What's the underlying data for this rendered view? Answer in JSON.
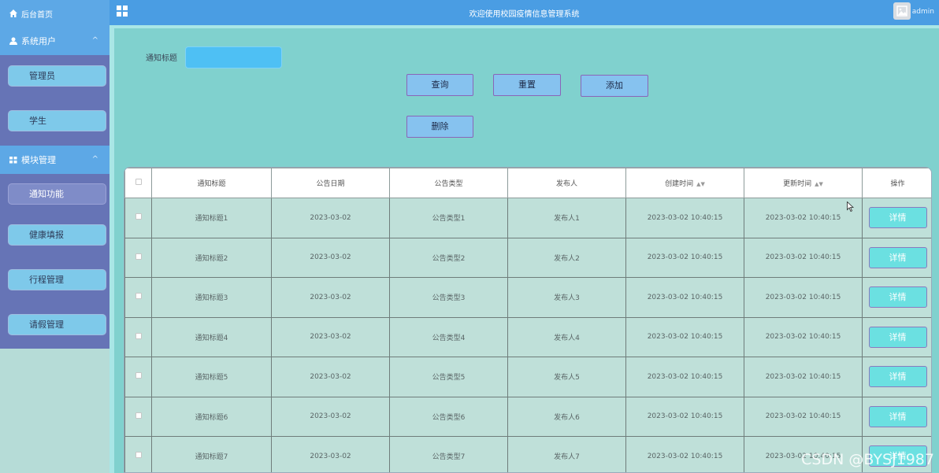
{
  "sidebar": {
    "home_label": "后台首页",
    "groups": [
      {
        "label": "系统用户",
        "items": [
          "管理员",
          "学生"
        ]
      },
      {
        "label": "模块管理",
        "items": [
          "通知功能",
          "健康填报",
          "行程管理",
          "请假管理"
        ]
      }
    ],
    "active_item": "通知功能"
  },
  "header": {
    "title": "欢迎使用校园疫情信息管理系统",
    "user": "admin"
  },
  "search": {
    "label": "通知标题",
    "value": "",
    "placeholder": ""
  },
  "toolbar": {
    "query_label": "查询",
    "reset_label": "重置",
    "add_label": "添加",
    "delete_label": "删除"
  },
  "table": {
    "columns": [
      "通知标题",
      "公告日期",
      "公告类型",
      "发布人",
      "创建时间",
      "更新时间",
      "操作"
    ],
    "action_label": "详情",
    "rows": [
      [
        "通知标题1",
        "2023-03-02",
        "公告类型1",
        "发布人1",
        "2023-03-02 10:40:15",
        "2023-03-02 10:40:15"
      ],
      [
        "通知标题2",
        "2023-03-02",
        "公告类型2",
        "发布人2",
        "2023-03-02 10:40:15",
        "2023-03-02 10:40:15"
      ],
      [
        "通知标题3",
        "2023-03-02",
        "公告类型3",
        "发布人3",
        "2023-03-02 10:40:15",
        "2023-03-02 10:40:15"
      ],
      [
        "通知标题4",
        "2023-03-02",
        "公告类型4",
        "发布人4",
        "2023-03-02 10:40:15",
        "2023-03-02 10:40:15"
      ],
      [
        "通知标题5",
        "2023-03-02",
        "公告类型5",
        "发布人5",
        "2023-03-02 10:40:15",
        "2023-03-02 10:40:15"
      ],
      [
        "通知标题6",
        "2023-03-02",
        "公告类型6",
        "发布人6",
        "2023-03-02 10:40:15",
        "2023-03-02 10:40:15"
      ],
      [
        "通知标题7",
        "2023-03-02",
        "公告类型7",
        "发布人7",
        "2023-03-02 10:40:15",
        "2023-03-02 10:40:15"
      ]
    ]
  },
  "watermark": "CSDN @BYSJ1987",
  "colors": {
    "topbar": "#4a9de3",
    "sidebar_block": "#6674b6",
    "content_bg": "#80d1ce",
    "detail_button": "#6be0e1"
  }
}
